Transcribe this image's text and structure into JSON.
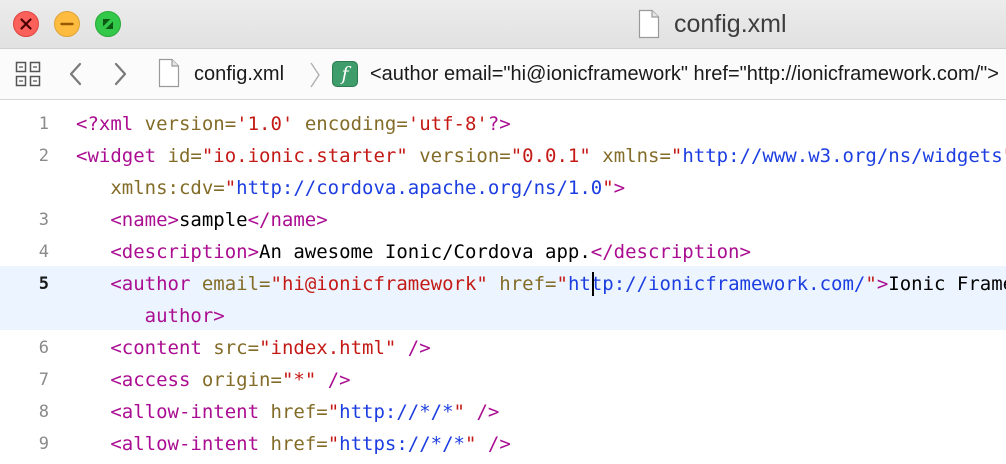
{
  "window": {
    "title": "config.xml"
  },
  "jumpbar": {
    "file": "config.xml",
    "symbol_badge": "f",
    "symbol": "<author email=\"hi@ionicframework\" href=\"http://ionicframework.com/\">"
  },
  "editor": {
    "current_line": 5,
    "lines": [
      {
        "number": "1",
        "tokens": [
          {
            "t": "<?xml",
            "c": "tag"
          },
          {
            "t": " ",
            "c": "txt"
          },
          {
            "t": "version=",
            "c": "attr"
          },
          {
            "t": "'1.0'",
            "c": "str"
          },
          {
            "t": " ",
            "c": "txt"
          },
          {
            "t": "encoding=",
            "c": "attr"
          },
          {
            "t": "'utf-8'",
            "c": "str"
          },
          {
            "t": "?>",
            "c": "tag"
          }
        ]
      },
      {
        "number": "2",
        "tokens": [
          {
            "t": "<widget",
            "c": "tag"
          },
          {
            "t": " ",
            "c": "txt"
          },
          {
            "t": "id=",
            "c": "attr"
          },
          {
            "t": "\"io.ionic.starter\"",
            "c": "str"
          },
          {
            "t": " ",
            "c": "txt"
          },
          {
            "t": "version=",
            "c": "attr"
          },
          {
            "t": "\"0.0.1\"",
            "c": "str"
          },
          {
            "t": " ",
            "c": "txt"
          },
          {
            "t": "xmlns=",
            "c": "attr"
          },
          {
            "t": "\"",
            "c": "str"
          },
          {
            "t": "http://www.w3.org/ns/widgets",
            "c": "url"
          },
          {
            "t": "\"",
            "c": "str"
          }
        ]
      },
      {
        "number": "",
        "indent": 3,
        "tokens": [
          {
            "t": "xmlns:cdv=",
            "c": "attr"
          },
          {
            "t": "\"",
            "c": "str"
          },
          {
            "t": "http://cordova.apache.org/ns/1.0",
            "c": "url"
          },
          {
            "t": "\"",
            "c": "str"
          },
          {
            "t": ">",
            "c": "tag"
          }
        ]
      },
      {
        "number": "3",
        "indent": 3,
        "tokens": [
          {
            "t": "<name>",
            "c": "tag"
          },
          {
            "t": "sample",
            "c": "txt"
          },
          {
            "t": "</name>",
            "c": "tag"
          }
        ]
      },
      {
        "number": "4",
        "indent": 3,
        "tokens": [
          {
            "t": "<description>",
            "c": "tag"
          },
          {
            "t": "An awesome Ionic/Cordova app.",
            "c": "txt"
          },
          {
            "t": "</description>",
            "c": "tag"
          }
        ]
      },
      {
        "number": "5",
        "indent": 3,
        "current": true,
        "tokens": [
          {
            "t": "<author",
            "c": "tag"
          },
          {
            "t": " ",
            "c": "txt"
          },
          {
            "t": "email=",
            "c": "attr"
          },
          {
            "t": "\"hi@ionicframework\"",
            "c": "str"
          },
          {
            "t": " ",
            "c": "txt"
          },
          {
            "t": "href=",
            "c": "attr"
          },
          {
            "t": "\"",
            "c": "str"
          },
          {
            "t": "http://ionicframework.com/",
            "c": "url"
          },
          {
            "t": "\"",
            "c": "str"
          },
          {
            "t": ">",
            "c": "tag"
          },
          {
            "t": "Ionic Framework Team",
            "c": "txt"
          },
          {
            "t": "</",
            "c": "tag"
          }
        ]
      },
      {
        "number": "",
        "indent": 6,
        "current": true,
        "tokens": [
          {
            "t": "author>",
            "c": "tag"
          }
        ]
      },
      {
        "number": "6",
        "indent": 3,
        "tokens": [
          {
            "t": "<content",
            "c": "tag"
          },
          {
            "t": " ",
            "c": "txt"
          },
          {
            "t": "src=",
            "c": "attr"
          },
          {
            "t": "\"index.html\"",
            "c": "str"
          },
          {
            "t": " ",
            "c": "txt"
          },
          {
            "t": "/>",
            "c": "tag"
          }
        ]
      },
      {
        "number": "7",
        "indent": 3,
        "tokens": [
          {
            "t": "<access",
            "c": "tag"
          },
          {
            "t": " ",
            "c": "txt"
          },
          {
            "t": "origin=",
            "c": "attr"
          },
          {
            "t": "\"*\"",
            "c": "str"
          },
          {
            "t": " ",
            "c": "txt"
          },
          {
            "t": "/>",
            "c": "tag"
          }
        ]
      },
      {
        "number": "8",
        "indent": 3,
        "tokens": [
          {
            "t": "<allow-intent",
            "c": "tag"
          },
          {
            "t": " ",
            "c": "txt"
          },
          {
            "t": "href=",
            "c": "attr"
          },
          {
            "t": "\"",
            "c": "str"
          },
          {
            "t": "http://*/*",
            "c": "url"
          },
          {
            "t": "\"",
            "c": "str"
          },
          {
            "t": " ",
            "c": "txt"
          },
          {
            "t": "/>",
            "c": "tag"
          }
        ]
      },
      {
        "number": "9",
        "indent": 3,
        "tokens": [
          {
            "t": "<allow-intent",
            "c": "tag"
          },
          {
            "t": " ",
            "c": "txt"
          },
          {
            "t": "href=",
            "c": "attr"
          },
          {
            "t": "\"",
            "c": "str"
          },
          {
            "t": "https://*/*",
            "c": "url"
          },
          {
            "t": "\"",
            "c": "str"
          },
          {
            "t": " ",
            "c": "txt"
          },
          {
            "t": "/>",
            "c": "tag"
          }
        ]
      }
    ]
  },
  "icons": {
    "close": "close-icon",
    "minimize": "minimize-icon",
    "zoom": "zoom-icon",
    "related_items": "related-items-grid-icon",
    "back": "chevron-left-icon",
    "forward": "chevron-right-icon",
    "document": "document-icon"
  },
  "colors": {
    "tag": "#aa0d91",
    "attribute": "#836c28",
    "string": "#c41a16",
    "url": "#1c3ee0",
    "current_line_highlight": "#ecf5ff",
    "close": "#fc605b",
    "minimize": "#fdbc40",
    "zoom": "#34c84a",
    "symbol_badge": "#3e9d6b"
  }
}
